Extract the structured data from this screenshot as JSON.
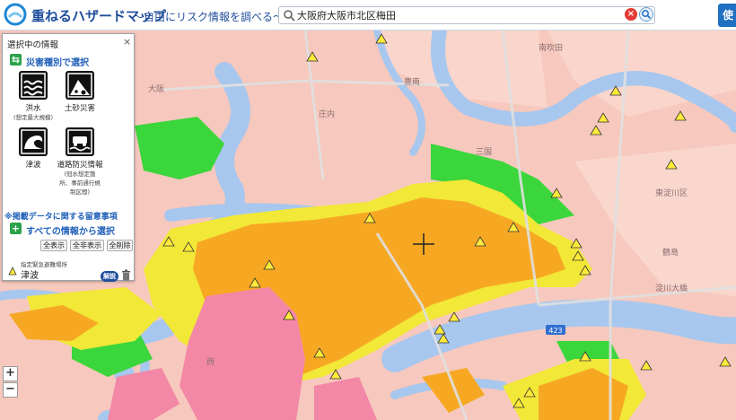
{
  "header": {
    "title": "重ねるハザードマップ",
    "subtitle": "〜自由にリスク情報を調べる〜",
    "search_value": "大阪府大阪市北区梅田",
    "right_button": "使"
  },
  "panel": {
    "title": "選択中の情報",
    "close_label": "×",
    "section_by_type": "災害種別で選択",
    "hazards": [
      {
        "icon": "flood-icon",
        "label": "洪水",
        "sub": "(想定最大規模)"
      },
      {
        "icon": "landslide-icon",
        "label": "土砂災害",
        "sub": ""
      },
      {
        "icon": "tsunami-icon",
        "label": "津波",
        "sub": ""
      },
      {
        "icon": "road-disaster-icon",
        "label": "道路防災情報",
        "sub_lines": [
          "(冠水想定箇",
          "所、事前通行規",
          "制区間)"
        ]
      }
    ],
    "notice_link": "※掲載データに関する留意事項",
    "section_all": "すべての情報から選択",
    "tools": {
      "show_all": "全表示",
      "hide_all": "全非表示",
      "delete_all": "全削除"
    },
    "layer": {
      "category": "指定緊急避難場所",
      "name": "津波",
      "legend_button": "解説"
    }
  },
  "map": {
    "labels": [
      {
        "key": "suita",
        "text": "南吹田"
      },
      {
        "key": "toyonan",
        "text": "豊南"
      },
      {
        "key": "shonai",
        "text": "庄内"
      },
      {
        "key": "juso",
        "text": "三国"
      },
      {
        "key": "higashi_yodogawa",
        "text": "東淀川区"
      },
      {
        "key": "yodogawa",
        "text": "淀川大橋"
      },
      {
        "key": "tsurumi",
        "text": "鶴島"
      },
      {
        "key": "osaka",
        "text": "大阪"
      },
      {
        "key": "nishi",
        "text": "西"
      }
    ],
    "route_number": "423",
    "colors": {
      "orange": "#f7a823",
      "yellow": "#f2e837",
      "pink": "#f287a6",
      "green": "#3bd63b",
      "river": "#a8c7ee",
      "base": "#f7c8bd"
    }
  },
  "zoom": {
    "in": "+",
    "out": "−"
  }
}
